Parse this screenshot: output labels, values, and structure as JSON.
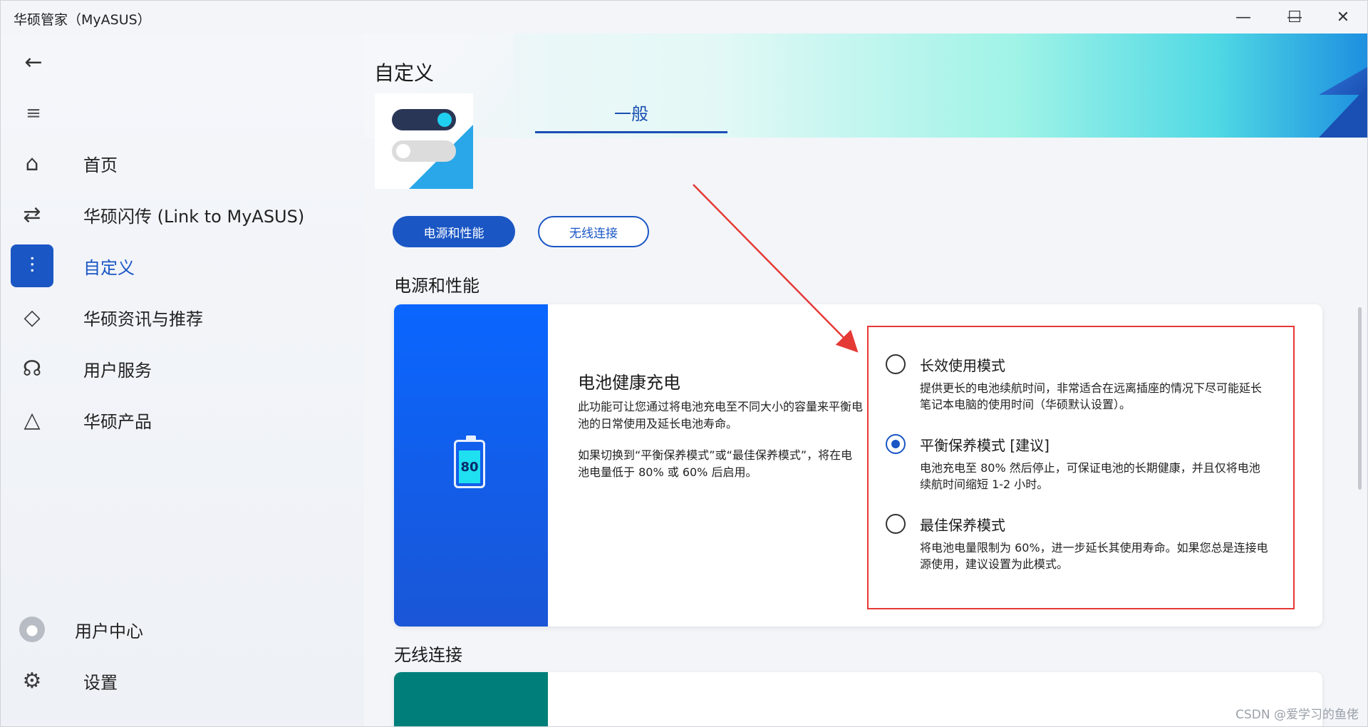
{
  "window": {
    "title": "华硕管家（MyASUS）",
    "minimize": "—",
    "maximize": "☐",
    "close": "✕"
  },
  "sidebar": {
    "back": "←",
    "menu": "≡",
    "items": [
      {
        "label": "首页",
        "icon": "⌂"
      },
      {
        "label": "华硕闪传 (Link to MyASUS)",
        "icon": "⇄"
      },
      {
        "label": "自定义",
        "icon": "⫶"
      },
      {
        "label": "华硕资讯与推荐",
        "icon": "◇"
      },
      {
        "label": "用户服务",
        "icon": "☊"
      },
      {
        "label": "华硕产品",
        "icon": "△"
      }
    ],
    "bottom": [
      {
        "label": "用户中心",
        "icon": "●"
      },
      {
        "label": "设置",
        "icon": "⚙"
      }
    ]
  },
  "main": {
    "title": "自定义",
    "tab": "一般",
    "pills": {
      "power": "电源和性能",
      "wireless": "无线连接"
    },
    "power_section": "电源和性能",
    "wireless_section": "无线连接",
    "battery": {
      "level": "80",
      "heading": "电池健康充电",
      "desc1": "此功能可让您通过将电池充电至不同大小的容量来平衡电池的日常使用及延长电池寿命。",
      "desc2": "如果切换到“平衡保养模式”或“最佳保养模式”，将在电池电量低于 80% 或 60% 后启用。",
      "modes": [
        {
          "title": "长效使用模式",
          "desc": "提供更长的电池续航时间，非常适合在远离插座的情况下尽可能延长笔记本电脑的使用时间（华硕默认设置）。",
          "checked": false
        },
        {
          "title": "平衡保养模式 [建议]",
          "desc": "电池充电至 80% 然后停止，可保证电池的长期健康，并且仅将电池续航时间缩短 1-2 小时。",
          "checked": true
        },
        {
          "title": "最佳保养模式",
          "desc": "将电池电量限制为 60%，进一步延长其使用寿命。如果您总是连接电源使用，建议设置为此模式。",
          "checked": false
        }
      ]
    }
  },
  "colors": {
    "accent": "#1a56c4",
    "highlight": "#e53935",
    "wireless_card": "#007f7a"
  },
  "watermark": "CSDN @爱学习的鱼佬"
}
